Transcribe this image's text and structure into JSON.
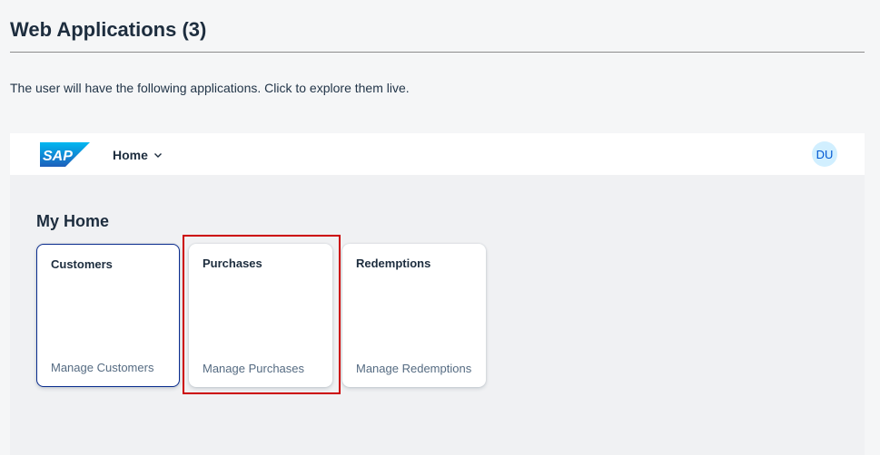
{
  "page": {
    "title": "Web Applications (3)",
    "intro": "The user will have the following applications. Click to explore them live."
  },
  "shell": {
    "logo_text": "SAP",
    "menu_label": "Home",
    "avatar_initials": "DU"
  },
  "home": {
    "section_title": "My Home",
    "tiles": [
      {
        "title": "Customers",
        "subtitle": "Manage Customers"
      },
      {
        "title": "Purchases",
        "subtitle": "Manage Purchases"
      },
      {
        "title": "Redemptions",
        "subtitle": "Manage Redemptions"
      }
    ]
  },
  "colors": {
    "brand_blue": "#0a6ed1",
    "highlight_red": "#cc0000",
    "avatar_bg": "#d1efff"
  }
}
